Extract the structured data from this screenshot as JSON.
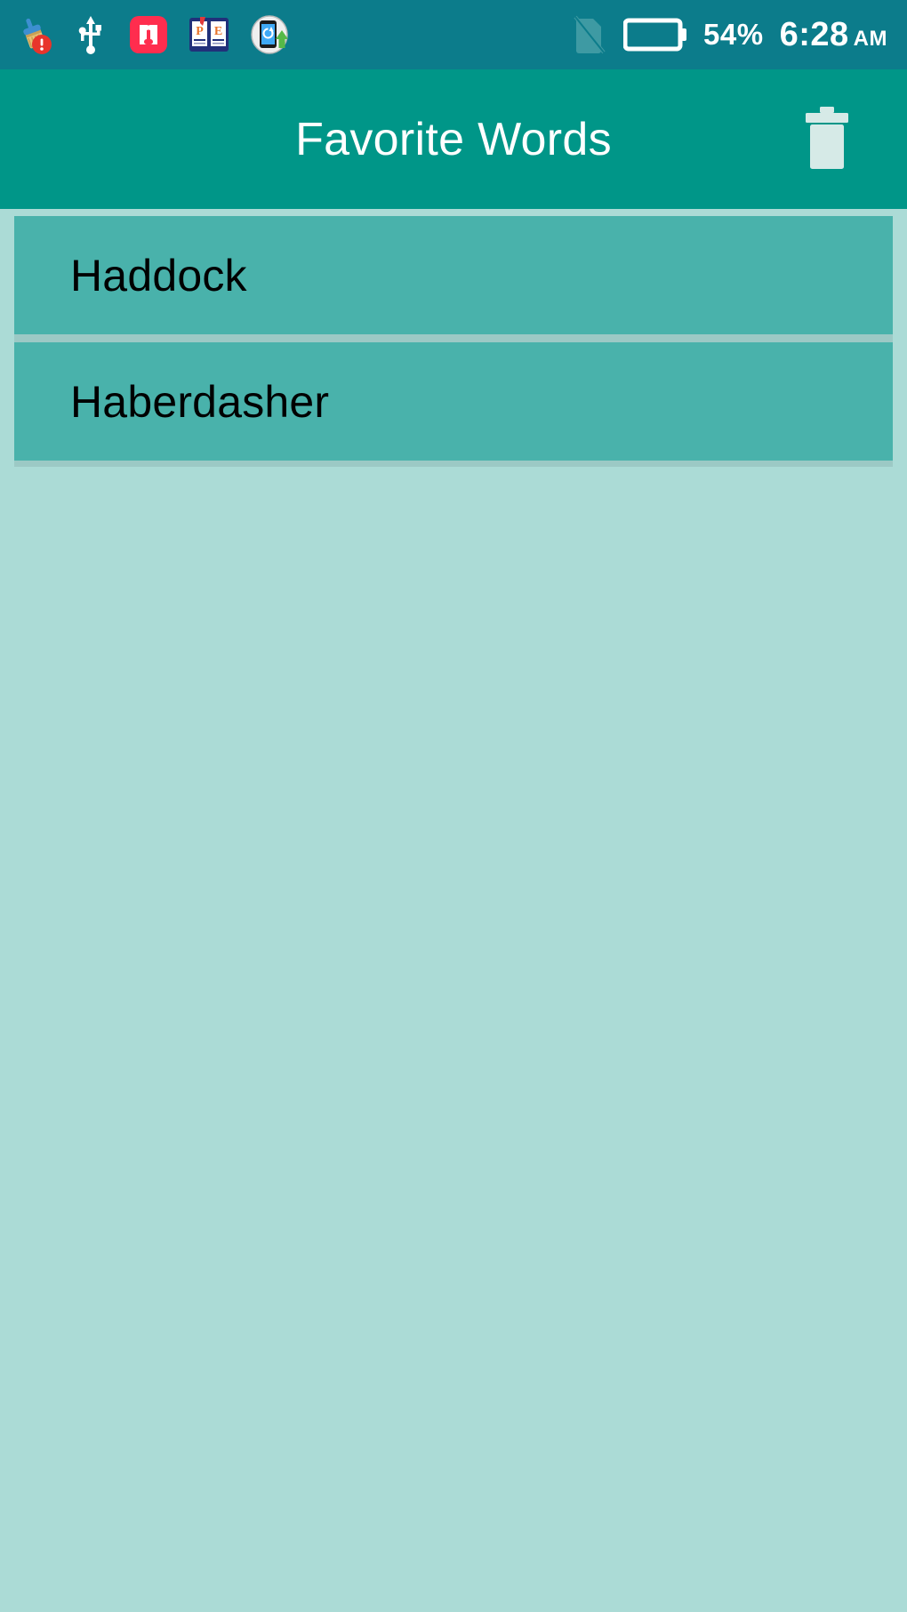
{
  "status_bar": {
    "background_color": "#0C7C8B",
    "left_icons": [
      {
        "name": "cleaner-broom-alert-icon",
        "label": "Cleaner alert"
      },
      {
        "name": "usb-icon",
        "label": "USB connected"
      },
      {
        "name": "app-red-h-icon",
        "label": "App notification"
      },
      {
        "name": "dictionary-book-icon",
        "label": "Dictionary"
      },
      {
        "name": "system-update-phone-icon",
        "label": "System update"
      }
    ],
    "right_icons": [
      {
        "name": "no-sim-card-icon",
        "label": "No SIM card"
      },
      {
        "name": "battery-charging-icon",
        "label": "Battery charging"
      }
    ],
    "battery_percent": "54%",
    "time": "6:28",
    "meridiem": "AM"
  },
  "app_bar": {
    "title": "Favorite Words",
    "background_color": "#009688",
    "title_color": "#FFFFFF",
    "actions": [
      {
        "name": "delete-all-button",
        "icon": "trash-icon",
        "label": "Delete all"
      }
    ]
  },
  "list": {
    "background_color": "#ABDBD6",
    "item_color": "#49B2AB",
    "divider_color": "#9CC9C5",
    "text_color": "#000000",
    "items": [
      {
        "label": "Haddock"
      },
      {
        "label": "Haberdasher"
      }
    ]
  }
}
